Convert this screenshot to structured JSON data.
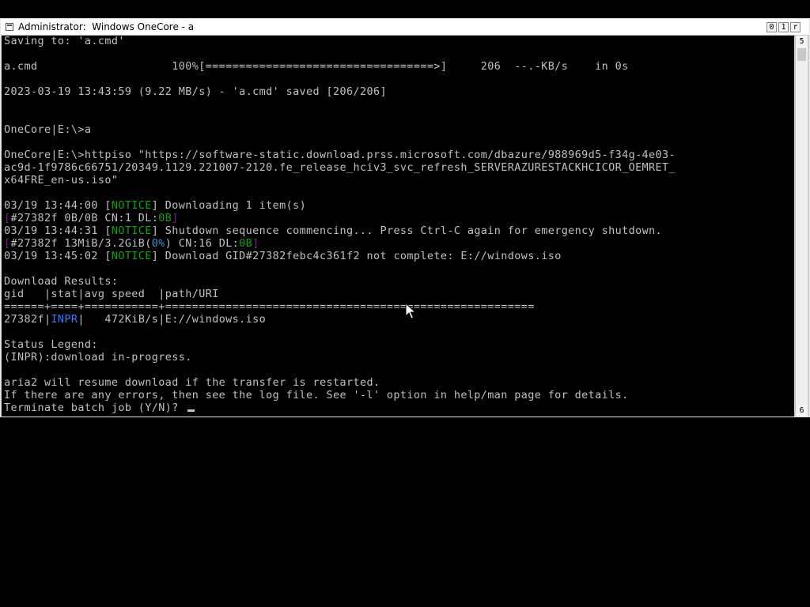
{
  "window": {
    "title": "Administrator:  Windows OneCore - a",
    "controls": {
      "minimize": "0",
      "maximize": "1",
      "close": "r"
    }
  },
  "scrollbar": {
    "up_arrow": "5",
    "down_arrow": "6"
  },
  "colors": {
    "green": "#13a10e",
    "magenta": "#881798",
    "cyan": "#3a96dd",
    "blue": "#3b78ff",
    "text": "#c0c0c0"
  },
  "console": {
    "lines": [
      [
        {
          "t": "Saving to: 'a.cmd'"
        }
      ],
      [],
      [
        {
          "t": "a.cmd                    100%[==================================>]     206  --.-KB/s    in 0s"
        }
      ],
      [],
      [
        {
          "t": "2023-03-19 13:43:59 (9.22 MB/s) - 'a.cmd' saved [206/206]"
        }
      ],
      [],
      [],
      [
        {
          "t": "OneCore|E:\\>a"
        }
      ],
      [],
      [
        {
          "t": "OneCore|E:\\>httpiso \"https://software-static.download.prss.microsoft.com/dbazure/988969d5-f34g-4e03-"
        }
      ],
      [
        {
          "t": "ac9d-1f9786c66751/20349.1129.221007-2120.fe_release_hciv3_svc_refresh_SERVERAZURESTACKHCICOR_OEMRET_"
        }
      ],
      [
        {
          "t": "x64FRE_en-us.iso\""
        }
      ],
      [],
      [
        {
          "t": "03/19 13:44:00 ["
        },
        {
          "t": "NOTICE",
          "c": "green"
        },
        {
          "t": "] Downloading 1 item(s)"
        }
      ],
      [
        {
          "t": "[",
          "c": "magenta"
        },
        {
          "t": "#27382f 0B/0B CN:1 DL:"
        },
        {
          "t": "0B",
          "c": "green"
        },
        {
          "t": "]",
          "c": "magenta"
        }
      ],
      [
        {
          "t": "03/19 13:44:31 ["
        },
        {
          "t": "NOTICE",
          "c": "green"
        },
        {
          "t": "] Shutdown sequence commencing... Press Ctrl-C again for emergency shutdown."
        }
      ],
      [
        {
          "t": "[",
          "c": "magenta"
        },
        {
          "t": "#27382f 13MiB/3.2GiB("
        },
        {
          "t": "0%",
          "c": "cyan"
        },
        {
          "t": ") CN:16 DL:"
        },
        {
          "t": "0B",
          "c": "green"
        },
        {
          "t": "]",
          "c": "magenta"
        }
      ],
      [
        {
          "t": "03/19 13:45:02 ["
        },
        {
          "t": "NOTICE",
          "c": "green"
        },
        {
          "t": "] Download GID#27382febc4c361f2 not complete: E://windows.iso"
        }
      ],
      [],
      [
        {
          "t": "Download Results:"
        }
      ],
      [
        {
          "t": "gid   |stat|avg speed  |path/URI"
        }
      ],
      [
        {
          "t": "======+====+===========+======================================================="
        }
      ],
      [
        {
          "t": "27382f|"
        },
        {
          "t": "INPR",
          "c": "blue"
        },
        {
          "t": "|   472KiB/s|E://windows.iso"
        }
      ],
      [],
      [
        {
          "t": "Status Legend:"
        }
      ],
      [
        {
          "t": "(INPR):download in-progress."
        }
      ],
      [],
      [
        {
          "t": "aria2 will resume download if the transfer is restarted."
        }
      ],
      [
        {
          "t": "If there are any errors, then see the log file. See '-l' option in help/man page for details."
        }
      ],
      [
        {
          "t": "Terminate batch job (Y/N)? "
        }
      ]
    ]
  }
}
